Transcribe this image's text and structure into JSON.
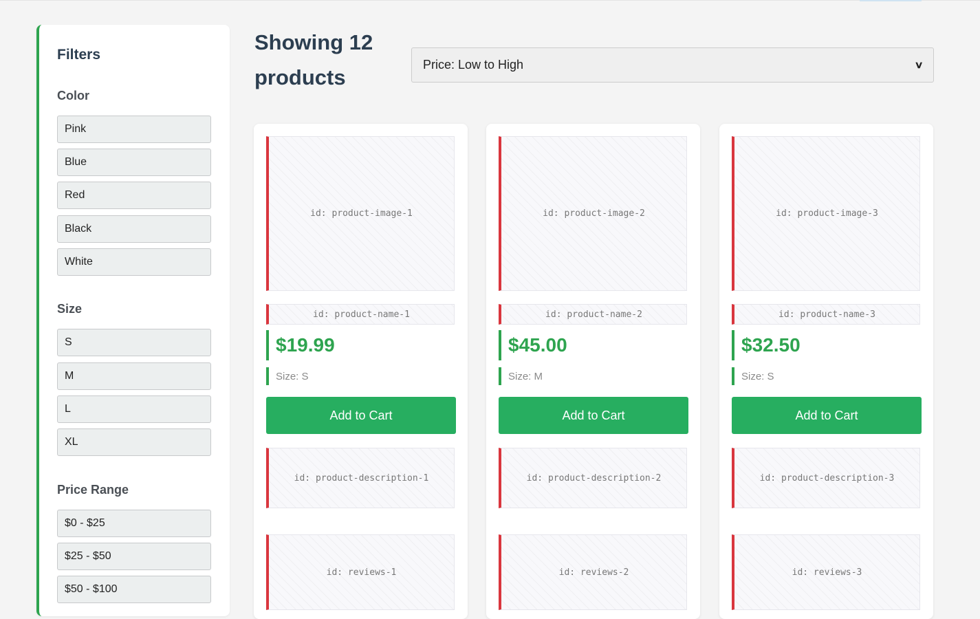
{
  "sidebar": {
    "title": "Filters",
    "groups": [
      {
        "title": "Color",
        "options": [
          "Pink",
          "Blue",
          "Red",
          "Black",
          "White"
        ]
      },
      {
        "title": "Size",
        "options": [
          "S",
          "M",
          "L",
          "XL"
        ]
      },
      {
        "title": "Price Range",
        "options": [
          "$0 - $25",
          "$25 - $50",
          "$50 - $100"
        ]
      }
    ]
  },
  "header": {
    "title": "Showing 12 products",
    "sort": {
      "selected": "Price: Low to High",
      "icon": "chevron-down-icon"
    }
  },
  "products": [
    {
      "image": "id: product-image-1",
      "name": "id: product-name-1",
      "price": "$19.99",
      "size": "Size: S",
      "button": "Add to Cart",
      "description": "id: product-description-1",
      "reviews": "id: reviews-1"
    },
    {
      "image": "id: product-image-2",
      "name": "id: product-name-2",
      "price": "$45.00",
      "size": "Size: M",
      "button": "Add to Cart",
      "description": "id: product-description-2",
      "reviews": "id: reviews-2"
    },
    {
      "image": "id: product-image-3",
      "name": "id: product-name-3",
      "price": "$32.50",
      "size": "Size: S",
      "button": "Add to Cart",
      "description": "id: product-description-3",
      "reviews": "id: reviews-3"
    }
  ],
  "colors": {
    "accent_green": "#27ae60",
    "price_green": "#2ea44f",
    "placeholder_red": "#d9363e",
    "heading": "#2c3e50"
  }
}
